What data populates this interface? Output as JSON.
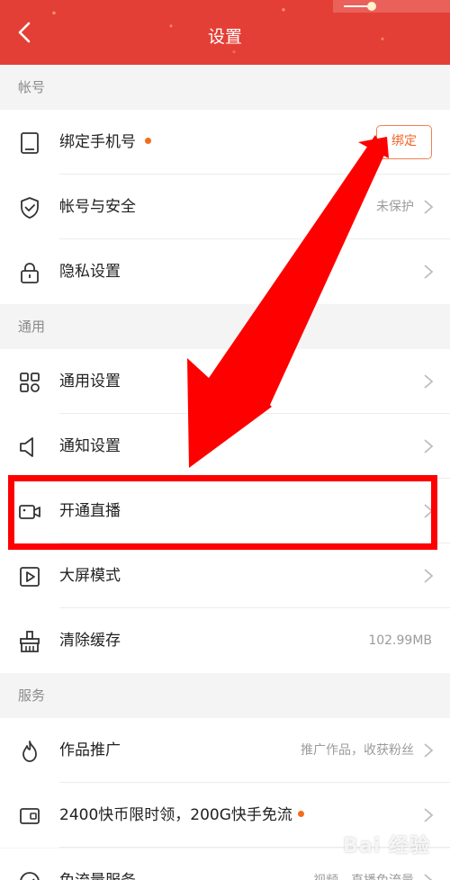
{
  "header": {
    "title": "设置"
  },
  "sections": {
    "account": "帐号",
    "general": "通用",
    "service": "服务"
  },
  "rows": {
    "bind_phone": {
      "label": "绑定手机号",
      "button": "绑定"
    },
    "account_security": {
      "label": "帐号与安全",
      "value": "未保护"
    },
    "privacy": {
      "label": "隐私设置"
    },
    "general_settings": {
      "label": "通用设置"
    },
    "notification": {
      "label": "通知设置"
    },
    "live": {
      "label": "开通直播"
    },
    "big_screen": {
      "label": "大屏模式"
    },
    "clear_cache": {
      "label": "清除缓存",
      "value": "102.99MB"
    },
    "promotion": {
      "label": "作品推广",
      "value": "推广作品，收获粉丝"
    },
    "coins": {
      "label": "2400快币限时领，200G快手免流"
    },
    "data_free": {
      "label": "免流量服务",
      "value": "视频、直播免流量"
    }
  },
  "watermark": "Bai 经验",
  "colors": {
    "header": "#e43f36",
    "accent_orange": "#f46c1b",
    "annotation_red": "#ff0000"
  },
  "icons": {
    "back": "chevron-left-icon",
    "bind_phone": "phone-icon",
    "account_security": "shield-icon",
    "privacy": "lock-icon",
    "general_settings": "grid-icon",
    "notification": "speaker-icon",
    "live": "video-camera-icon",
    "big_screen": "play-screen-icon",
    "clear_cache": "broom-icon",
    "promotion": "flame-icon",
    "coins": "wallet-icon",
    "data_free": "check-circle-icon"
  }
}
